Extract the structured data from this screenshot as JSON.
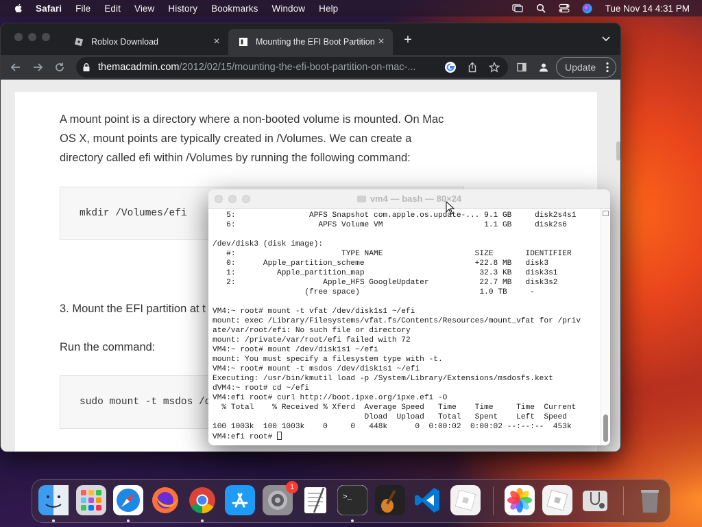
{
  "menubar": {
    "app": "Safari",
    "items": [
      "File",
      "Edit",
      "View",
      "History",
      "Bookmarks",
      "Window",
      "Help"
    ],
    "clock": "Tue Nov 14  4:31 PM",
    "status_icons": [
      "screen-mirroring-icon",
      "spotlight-search-icon",
      "control-center-icon",
      "siri-icon"
    ]
  },
  "browser": {
    "tabs": [
      {
        "title": "Roblox Download",
        "favicon": "roblox-icon",
        "active": false
      },
      {
        "title": "Mounting the EFI Boot Partition",
        "favicon": "page-icon",
        "active": true
      }
    ],
    "address": {
      "host": "themacadmin.com",
      "path": "/2012/02/15/mounting-the-efi-boot-partition-on-mac-..."
    },
    "update_label": "Update",
    "page": {
      "para1": [
        "A mount point is a directory where a non-booted volume is mounted.  On Mac",
        "OS X, mount points are typically created in /Volumes.  We can create a",
        "directory called efi within /Volumes by running the following command:"
      ],
      "code1": "mkdir /Volumes/efi",
      "step3": "3. Mount the EFI partition at t",
      "run": "Run the command:",
      "code2": "sudo mount -t msdos /dev"
    }
  },
  "terminal": {
    "title": "vm4 — bash — 80×24",
    "lines": [
      "   5:                APFS Snapshot com.apple.os.update-... 9.1 GB     disk2s4s1",
      "   6:                  APFS Volume VM                      1.1 GB     disk2s6",
      "",
      "/dev/disk3 (disk image):",
      "   #:                       TYPE NAME                    SIZE       IDENTIFIER",
      "   0:      Apple_partition_scheme                        +22.8 MB   disk3",
      "   1:         Apple_partition_map                         32.3 KB   disk3s1",
      "   2:                   Apple_HFS GoogleUpdater           22.7 MB   disk3s2",
      "                    (free space)                          1.0 TB     -",
      "",
      "VM4:~ root# mount -t vfat /dev/disk1s1 ~/efi",
      "mount: exec /Library/Filesystems/vfat.fs/Contents/Resources/mount_vfat for /priv",
      "ate/var/root/efi: No such file or directory",
      "mount: /private/var/root/efi failed with 72",
      "VM4:~ root# mount /dev/disk1s1 ~/efi",
      "mount: You must specify a filesystem type with -t.",
      "VM4:~ root# mount -t msdos /dev/disk1s1 ~/efi",
      "Executing: /usr/bin/kmutil load -p /System/Library/Extensions/msdosfs.kext",
      "dVM4:~ root# cd ~/efi",
      "VM4:efi root# curl http://boot.ipxe.org/ipxe.efi -O",
      "  % Total    % Received % Xferd  Average Speed   Time    Time     Time  Current",
      "                                 Dload  Upload   Total   Spent    Left  Speed",
      "100 1003k  100 1003k    0     0   448k      0  0:00:02  0:00:02 --:--:--  453k",
      "VM4:efi root# "
    ]
  },
  "dock": {
    "items": [
      {
        "name": "finder-icon",
        "running": true
      },
      {
        "name": "launchpad-icon",
        "running": false
      },
      {
        "name": "safari-icon",
        "running": true
      },
      {
        "name": "firefox-icon",
        "running": false
      },
      {
        "name": "chrome-icon",
        "running": true
      },
      {
        "name": "app-store-icon",
        "running": false
      },
      {
        "name": "system-settings-icon",
        "running": false,
        "badge": "1"
      },
      {
        "name": "textedit-icon",
        "running": false
      },
      {
        "name": "terminal-icon",
        "running": true
      },
      {
        "name": "garageband-icon",
        "running": false
      },
      {
        "name": "vscode-icon",
        "running": false
      },
      {
        "name": "roblox-icon",
        "running": false
      },
      {
        "name": "photos-icon",
        "running": false
      },
      {
        "name": "roblox-studio-icon",
        "running": false
      },
      {
        "name": "disk-utility-icon",
        "running": false
      },
      {
        "name": "trash-icon",
        "running": false
      }
    ]
  }
}
